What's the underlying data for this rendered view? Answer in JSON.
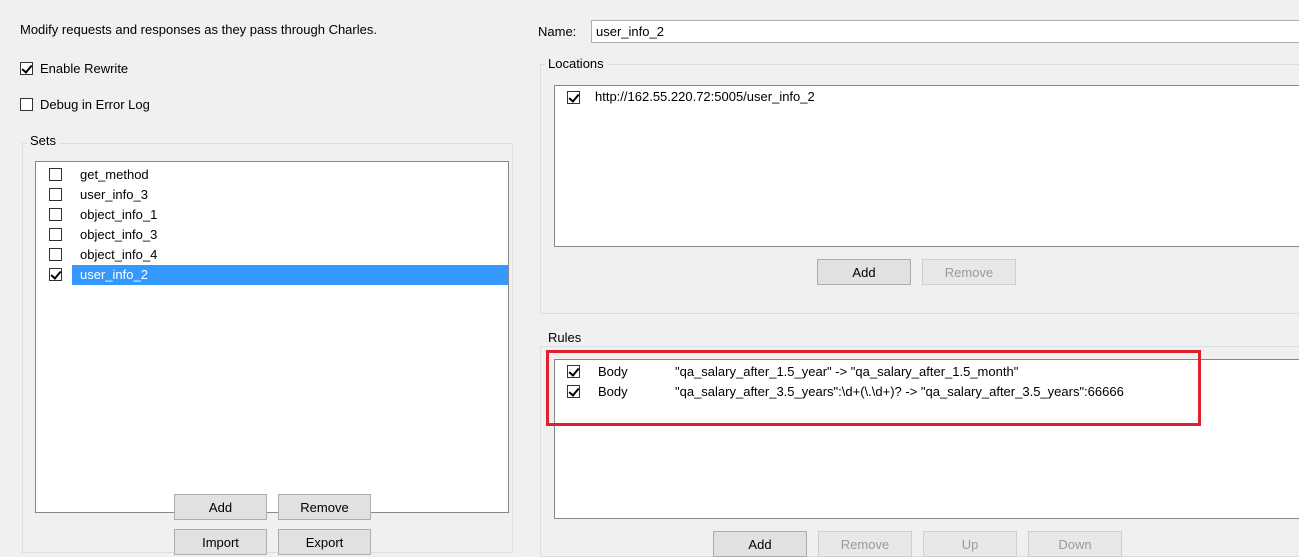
{
  "left": {
    "description": "Modify requests and responses as they pass through Charles.",
    "enable_rewrite": {
      "label": "Enable Rewrite",
      "checked": true
    },
    "debug_log": {
      "label": "Debug in Error Log",
      "checked": false
    },
    "sets": {
      "title": "Sets",
      "items": [
        {
          "label": "get_method",
          "checked": false,
          "selected": false
        },
        {
          "label": "user_info_3",
          "checked": false,
          "selected": false
        },
        {
          "label": "object_info_1",
          "checked": false,
          "selected": false
        },
        {
          "label": "object_info_3",
          "checked": false,
          "selected": false
        },
        {
          "label": "object_info_4",
          "checked": false,
          "selected": false
        },
        {
          "label": "user_info_2",
          "checked": true,
          "selected": true
        }
      ],
      "add_label": "Add",
      "remove_label": "Remove",
      "import_label": "Import",
      "export_label": "Export"
    }
  },
  "right": {
    "name_label": "Name:",
    "name_value": "user_info_2",
    "locations": {
      "title": "Locations",
      "items": [
        {
          "label": "http://162.55.220.72:5005/user_info_2",
          "checked": true
        }
      ],
      "add_label": "Add",
      "remove_label": "Remove"
    },
    "rules": {
      "title": "Rules",
      "items": [
        {
          "checked": true,
          "type": "Body",
          "rule": "\"qa_salary_after_1.5_year\" -> \"qa_salary_after_1.5_month\""
        },
        {
          "checked": true,
          "type": "Body",
          "rule": "\"qa_salary_after_3.5_years\":\\d+(\\.\\d+)? -> \"qa_salary_after_3.5_years\":66666"
        }
      ],
      "add_label": "Add",
      "remove_label": "Remove",
      "up_label": "Up",
      "down_label": "Down"
    }
  },
  "colors": {
    "selection": "#3399ff",
    "highlight_border": "#e0202a",
    "panel_bg": "#f0f0f0"
  }
}
